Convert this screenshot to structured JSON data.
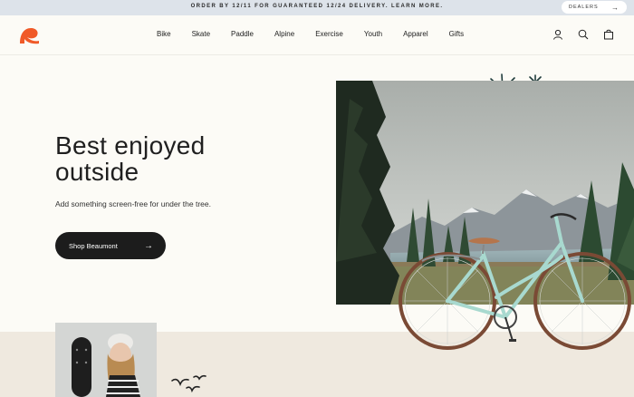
{
  "announcement": {
    "text": "ORDER BY 12/11 FOR GUARANTEED 12/24 DELIVERY. LEARN MORE.",
    "dealers_label": "DEALERS"
  },
  "header": {
    "nav": [
      "Bike",
      "Skate",
      "Paddle",
      "Alpine",
      "Exercise",
      "Youth",
      "Apparel",
      "Gifts"
    ],
    "icons": [
      "account-icon",
      "search-icon",
      "cart-icon"
    ]
  },
  "hero": {
    "headline": "Best enjoyed\noutside",
    "subtitle": "Add something screen-free for under the tree.",
    "cta_label": "Shop Beaumont"
  },
  "colors": {
    "brand": "#f05a28",
    "announce_bg": "#dde3ea",
    "page_bg": "#fcfbf6",
    "band_bg": "#efe9df",
    "button_bg": "#1c1c1c"
  }
}
